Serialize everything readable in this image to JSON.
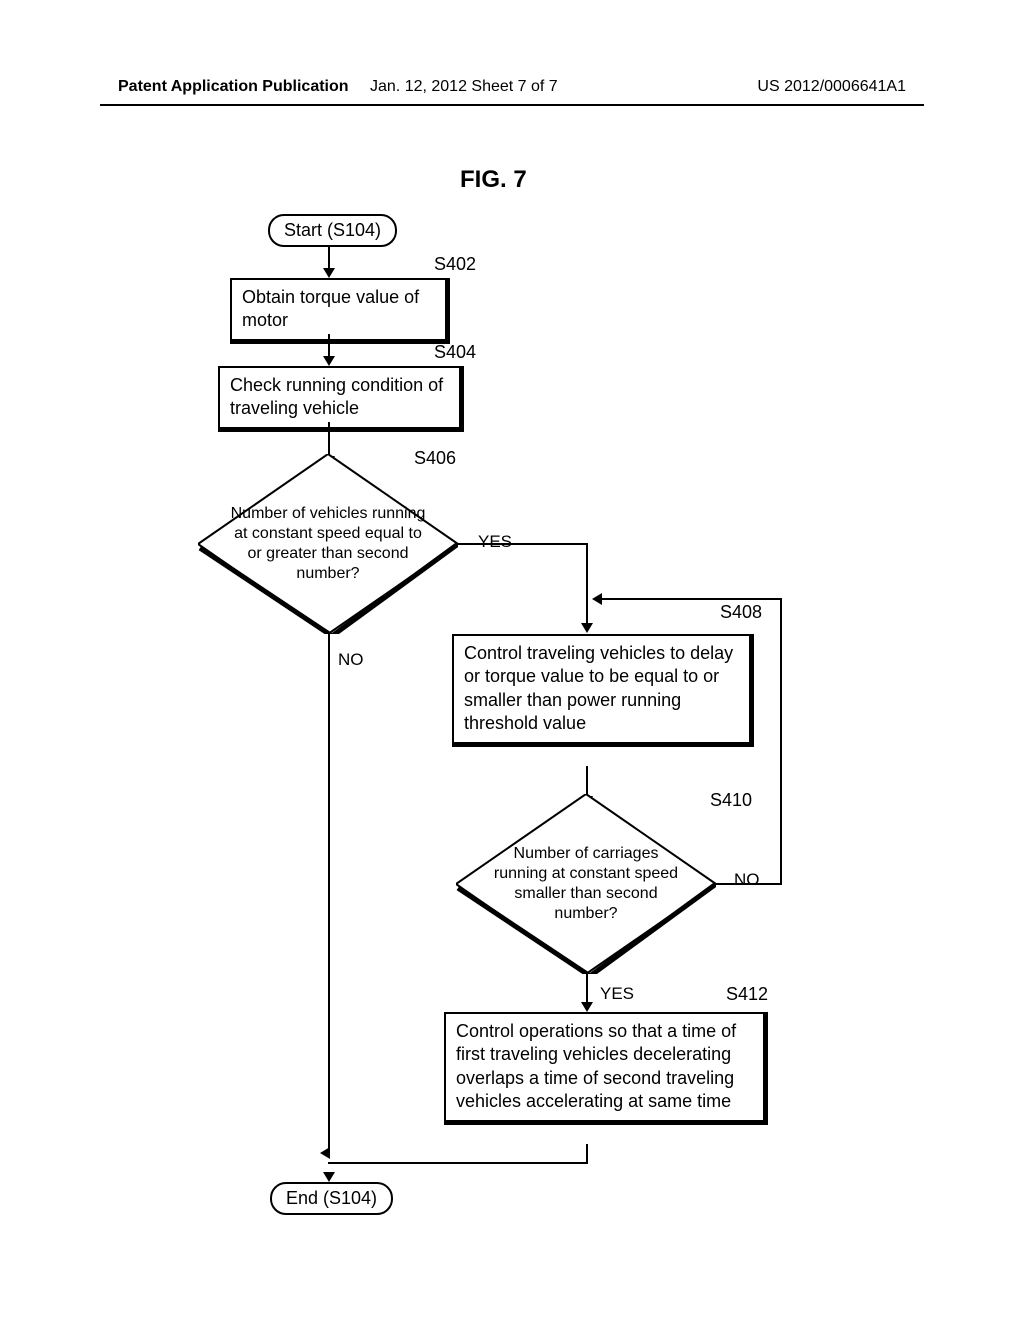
{
  "header": {
    "left": "Patent Application Publication",
    "date": "Jan. 12, 2012",
    "sheet": "Sheet 7 of 7",
    "pubno": "US 2012/0006641A1"
  },
  "figure_title": "FIG. 7",
  "steps": {
    "start": "Start (S104)",
    "s402_label": "S402",
    "s402_text": "Obtain torque value of motor",
    "s404_label": "S404",
    "s404_text": "Check running condition of traveling vehicle",
    "s406_label": "S406",
    "s406_text": "Number of vehicles running at constant speed equal to or greater than second number?",
    "s408_label": "S408",
    "s408_text": "Control traveling vehicles to delay or torque value to be equal to or smaller than power running threshold value",
    "s410_label": "S410",
    "s410_text": "Number of carriages running at constant speed smaller than second number?",
    "s412_label": "S412",
    "s412_text": "Control operations so that a time of first traveling vehicles decelerating overlaps a time of second traveling vehicles accelerating at same time",
    "end": "End (S104)"
  },
  "labels": {
    "yes": "YES",
    "no": "NO"
  }
}
